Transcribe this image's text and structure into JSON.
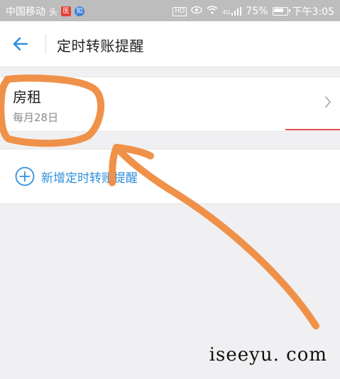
{
  "status_bar": {
    "carrier": "中国移动",
    "badge_1": "头",
    "badge_2": "医",
    "badge_3": "知",
    "hd_label": "HD",
    "network": "4G",
    "battery": "75%",
    "time": "下午3:05"
  },
  "header": {
    "title": "定时转账提醒",
    "back_icon": "back-arrow-icon"
  },
  "reminders": [
    {
      "name": "房租",
      "schedule": "每月28日"
    }
  ],
  "add_reminder": {
    "label": "新增定时转账提醒",
    "icon": "plus-circle-icon"
  },
  "watermark": "iseeyu. com",
  "colors": {
    "accent": "#2f8fde",
    "annotation": "#f0914a",
    "status_bar": "#bdbdbd"
  }
}
